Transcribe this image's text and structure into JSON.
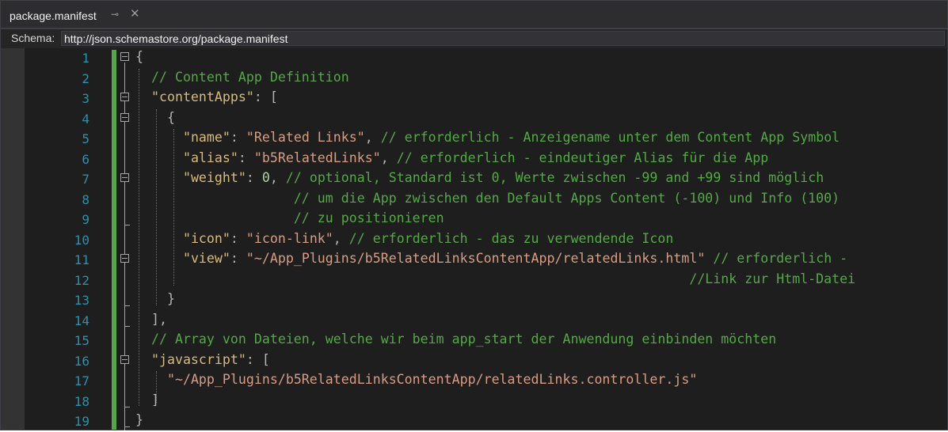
{
  "tab": {
    "title": "package.manifest",
    "pin_glyph": "⊸",
    "close_glyph": "✕"
  },
  "schema": {
    "label": "Schema:",
    "value": "http://json.schemastore.org/package.manifest"
  },
  "lines": [
    {
      "no": "1"
    },
    {
      "no": "2"
    },
    {
      "no": "3"
    },
    {
      "no": "4"
    },
    {
      "no": "5"
    },
    {
      "no": "6"
    },
    {
      "no": "7"
    },
    {
      "no": "8"
    },
    {
      "no": "9"
    },
    {
      "no": "10"
    },
    {
      "no": "11"
    },
    {
      "no": "12"
    },
    {
      "no": "13"
    },
    {
      "no": "14"
    },
    {
      "no": "15"
    },
    {
      "no": "16"
    },
    {
      "no": "17"
    },
    {
      "no": "18"
    },
    {
      "no": "19"
    }
  ],
  "code": {
    "l1": {
      "brace": "{"
    },
    "l2": {
      "comment": "// Content App Definition"
    },
    "l3": {
      "key": "\"contentApps\"",
      "rest": ": ["
    },
    "l4": {
      "brace": "{"
    },
    "l5": {
      "key": "\"name\"",
      "colon": ": ",
      "value": "\"Related Links\"",
      "comma": ", ",
      "comment": "// erforderlich - Anzeigename unter dem Content App Symbol"
    },
    "l6": {
      "key": "\"alias\"",
      "colon": ": ",
      "value": "\"b5RelatedLinks\"",
      "comma": ", ",
      "comment": "// erforderlich - eindeutiger Alias für die App"
    },
    "l7": {
      "key": "\"weight\"",
      "colon": ": ",
      "value": "0",
      "comma": ", ",
      "comment": "// optional, Standard ist 0, Werte zwischen -99 and +99 sind möglich"
    },
    "l8": {
      "comment": "// um die App zwischen den Default Apps Content (-100) und Info (100)"
    },
    "l9": {
      "comment": "// zu positionieren"
    },
    "l10": {
      "key": "\"icon\"",
      "colon": ": ",
      "value": "\"icon-link\"",
      "comma": ", ",
      "comment": "// erforderlich - das zu verwendende Icon"
    },
    "l11": {
      "key": "\"view\"",
      "colon": ": ",
      "value": "\"~/App_Plugins/b5RelatedLinksContentApp/relatedLinks.html\"",
      "comma": " ",
      "comment": "// erforderlich -"
    },
    "l12": {
      "comment": "//Link zur Html-Datei"
    },
    "l13": {
      "brace": "}"
    },
    "l14": {
      "brace": "],"
    },
    "l15": {
      "comment": "// Array von Dateien, welche wir beim app_start der Anwendung einbinden möchten"
    },
    "l16": {
      "key": "\"javascript\"",
      "rest": ": ["
    },
    "l17": {
      "value": "\"~/App_Plugins/b5RelatedLinksContentApp/relatedLinks.controller.js\""
    },
    "l18": {
      "brace": "]"
    },
    "l19": {
      "brace": "}"
    }
  },
  "colors": {
    "background": "#1e1e1e",
    "line_number": "#2b91af",
    "key": "#d7ba7d",
    "string": "#d69d85",
    "number": "#b5cea8",
    "comment": "#57a64a",
    "change_bar": "#57a64a"
  }
}
